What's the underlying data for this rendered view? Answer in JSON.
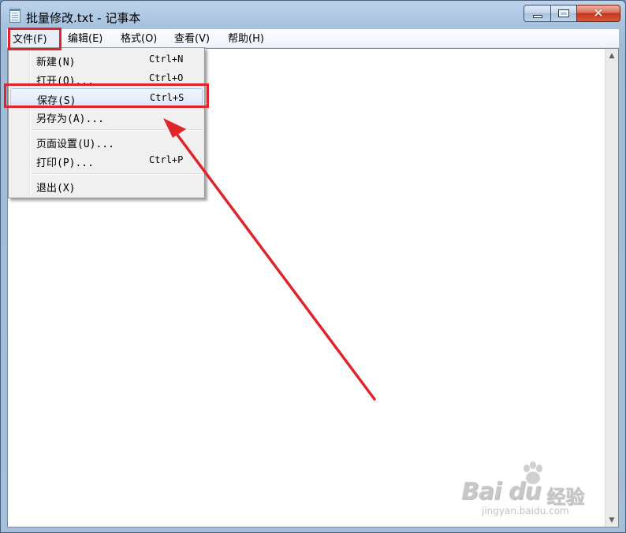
{
  "window": {
    "title": "批量修改.txt - 记事本",
    "close_glyph": "✕"
  },
  "menubar": {
    "items": [
      {
        "label": "文件(F)"
      },
      {
        "label": "编辑(E)"
      },
      {
        "label": "格式(O)"
      },
      {
        "label": "查看(V)"
      },
      {
        "label": "帮助(H)"
      }
    ]
  },
  "file_menu": {
    "items": [
      {
        "label": "新建(N)",
        "accel": "Ctrl+N"
      },
      {
        "label": "打开(O)...",
        "accel": "Ctrl+O"
      },
      {
        "label": "保存(S)",
        "accel": "Ctrl+S",
        "highlighted": true
      },
      {
        "label": "另存为(A)...",
        "accel": ""
      },
      {
        "label": "页面设置(U)...",
        "accel": ""
      },
      {
        "label": "打印(P)...",
        "accel": "Ctrl+P"
      },
      {
        "label": "退出(X)",
        "accel": ""
      }
    ]
  },
  "editor": {
    "content": ""
  },
  "scrollbar": {
    "up_glyph": "▲",
    "down_glyph": "▼"
  },
  "watermark": {
    "brand_latin": "Bai du",
    "brand_cn": "经验",
    "url": "jingyan.baidu.com"
  },
  "icons": {
    "app": "notepad-icon",
    "minimize": "minimize-icon",
    "maximize": "maximize-icon",
    "close": "close-icon",
    "paw": "baidu-paw-icon"
  },
  "colors": {
    "annotation_red": "#e0242b",
    "menu_hover": "#dde8f6",
    "titlebar": "#a9c3df"
  }
}
